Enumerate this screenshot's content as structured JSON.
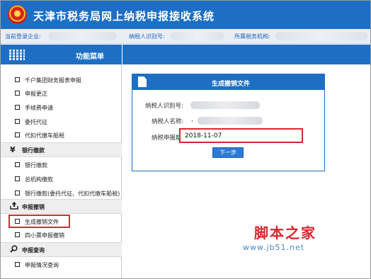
{
  "app": {
    "title": "天津市税务局网上纳税申报接收系统",
    "emblem_icon": "tax-emblem-icon"
  },
  "infobar": {
    "enterprise_label": "当前登录企业:",
    "taxpayer_id_label": "纳税人识别号:",
    "tax_authority_label": "所属税务机构:"
  },
  "sidebar": {
    "title": "功能菜单",
    "items_top": [
      {
        "label": "千户集团财务报表申报"
      },
      {
        "label": "申报更正"
      },
      {
        "label": "手续费申请"
      },
      {
        "label": "委托代征"
      },
      {
        "label": "代扣代缴车船税"
      }
    ],
    "groups": [
      {
        "label": "银行缴款",
        "icon": "yen-icon",
        "items": [
          {
            "label": "银行缴款"
          },
          {
            "label": "总机构缴款"
          },
          {
            "label": "银行缴款(委托代征、代扣代缴车船税)"
          }
        ]
      },
      {
        "label": "申报撤销",
        "icon": "upload-icon",
        "items": [
          {
            "label": "生成撤销文件"
          },
          {
            "label": "四小票申报撤销"
          }
        ]
      },
      {
        "label": "申报查询",
        "icon": "search-icon",
        "items": [
          {
            "label": "申报情况查询"
          }
        ]
      }
    ]
  },
  "panel": {
    "title": "生成撤销文件",
    "taxpayer_id_label": "纳税人识别号:",
    "taxpayer_name_label": "纳税人名称:",
    "taxpayer_name_prefix": ",",
    "period_label": "纳税申报期:",
    "period_value": "2018-11-07",
    "next_button": "下一步"
  },
  "watermark": {
    "text": "脚本之家",
    "url": "www.jb51.net"
  },
  "colors": {
    "primary": "#1e6fc4",
    "highlight": "#e0262f"
  }
}
